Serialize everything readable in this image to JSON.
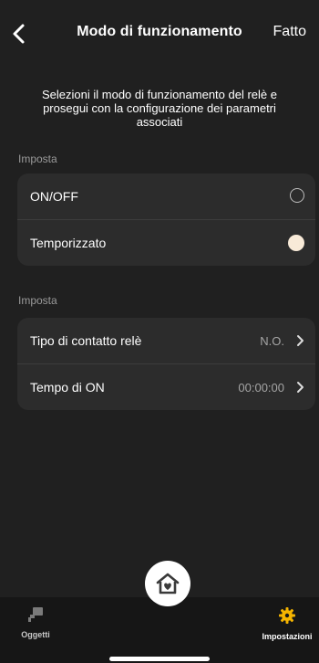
{
  "header": {
    "title": "Modo di funzionamento",
    "done_label": "Fatto"
  },
  "description": "Selezioni il modo di funzionamento del relè e prosegui con la configurazione dei parametri associati",
  "sections": [
    {
      "label": "Imposta",
      "items": [
        {
          "label": "ON/OFF",
          "selected": false
        },
        {
          "label": "Temporizzato",
          "selected": true
        }
      ]
    },
    {
      "label": "Imposta",
      "items": [
        {
          "label": "Tipo di contatto relè",
          "value": "N.O."
        },
        {
          "label": "Tempo di ON",
          "value": "00:00:00"
        }
      ]
    }
  ],
  "tabbar": {
    "tabs": [
      {
        "label": "Oggetti",
        "icon": "objects-icon",
        "active": false
      },
      {
        "label": "Impostazioni",
        "icon": "gear-icon",
        "active": true
      }
    ],
    "center_icon": "home-heart-icon"
  },
  "colors": {
    "background": "#202020",
    "card": "#2c2c2c",
    "accent": "#f5b400",
    "radio_selected": "#f8ead8",
    "muted_text": "#9a9a9a"
  }
}
